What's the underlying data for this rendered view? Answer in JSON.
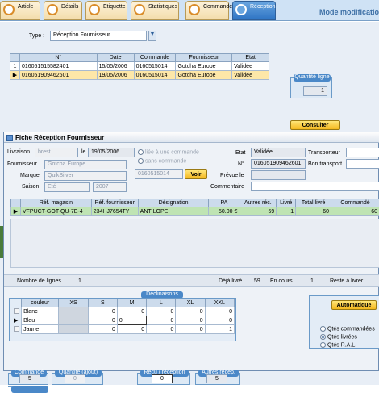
{
  "tabs": [
    {
      "label": "Article"
    },
    {
      "label": "Détails"
    },
    {
      "label": "Etiquette"
    },
    {
      "label": "Statistiques"
    },
    {
      "label": "Commande"
    },
    {
      "label": "Réception"
    }
  ],
  "mode_label": "Mode modificatio",
  "type_label": "Type :",
  "type_value": "Réception Fournisseur",
  "reception_table": {
    "headers": [
      "N°",
      "Date",
      "Commande",
      "Fournisseur",
      "Etat"
    ],
    "rows": [
      {
        "idx": "1",
        "num": "016051515582401",
        "date": "15/05/2006",
        "commande": "0160515014",
        "fournisseur": "Gotcha Europe",
        "etat": "Validée"
      },
      {
        "idx": "",
        "num": "016051909462601",
        "date": "19/05/2006",
        "commande": "0160515014",
        "fournisseur": "Gotcha Europe",
        "etat": "Validée"
      }
    ]
  },
  "quantite_ligne": {
    "label": "Quantité ligne",
    "value": "1"
  },
  "consulter_label": "Consulter",
  "popup": {
    "title": "Fiche Réception Fournisseur",
    "livraison_label": "Livraison",
    "livraison_value": "brest",
    "le_label": "le",
    "date_value": "19/05/2006",
    "radio_liee": "liée à une commande",
    "radio_sans": "sans commande",
    "fournisseur_label": "Fournisseur",
    "fournisseur_value": "Gotcha Europe",
    "marque_label": "Marque",
    "marque_value": "QuikSilver",
    "saison_label": "Saison",
    "saison_value": "Eté",
    "saison_year": "2007",
    "commande_value": "0160515014",
    "voir_label": "Voir",
    "etat_label": "Etat",
    "etat_value": "Validée",
    "num_label": "N°",
    "num_value": "016051909462601",
    "prevue_label": "Prévue le",
    "commentaire_label": "Commentaire",
    "transporteur_label": "Transporteur",
    "bon_transport_label": "Bon transport",
    "lines_table": {
      "headers": [
        "Réf. magasin",
        "Réf. fournisseur",
        "Désignation",
        "PA",
        "Autres réc.",
        "Livré",
        "Total livré",
        "Commandé"
      ],
      "row": {
        "ref_mag": "VFPUCT-GOT-QU-7E-4",
        "ref_four": "234HJ7654TY",
        "designation": "ANTILOPE",
        "pa": "50.00 €",
        "autres": "59",
        "livre": "1",
        "total": "60",
        "commande": "60"
      }
    },
    "nb_lignes_label": "Nombre de lignes",
    "nb_lignes_value": "1",
    "deja_livre_label": "Déjà livré",
    "deja_livre_value": "59",
    "en_cours_label": "En cours",
    "en_cours_value": "1",
    "reste_label": "Reste à livrer",
    "declinaisons": {
      "title": "Déclinaisons",
      "headers": [
        "couleur",
        "XS",
        "S",
        "M",
        "L",
        "XL",
        "XXL"
      ],
      "rows": [
        {
          "couleur": "Blanc",
          "xs": "",
          "s": "0",
          "m": "0",
          "l": "0",
          "xl": "0",
          "xxl": "0"
        },
        {
          "couleur": "Bleu",
          "xs": "",
          "s": "0",
          "m": "0",
          "l": "0",
          "xl": "0",
          "xxl": "0"
        },
        {
          "couleur": "Jaune",
          "xs": "",
          "s": "0",
          "m": "0",
          "l": "0",
          "xl": "0",
          "xxl": "1"
        }
      ]
    },
    "automatique_label": "Automatique",
    "qtes_commandees": "Qtés commandées",
    "qtes_livrees": "Qtés livrées",
    "qtes_ral": "Qtés R.A.L."
  },
  "bottom": {
    "commande": {
      "label": "Commandé",
      "value": "5"
    },
    "quantite_ajout": {
      "label": "Quantité (ajout)",
      "value": "0"
    },
    "recu_reception": {
      "label": "Reçu / réception",
      "value": "0"
    },
    "autres_recep": {
      "label": "Autres récep.",
      "value": "5"
    }
  }
}
